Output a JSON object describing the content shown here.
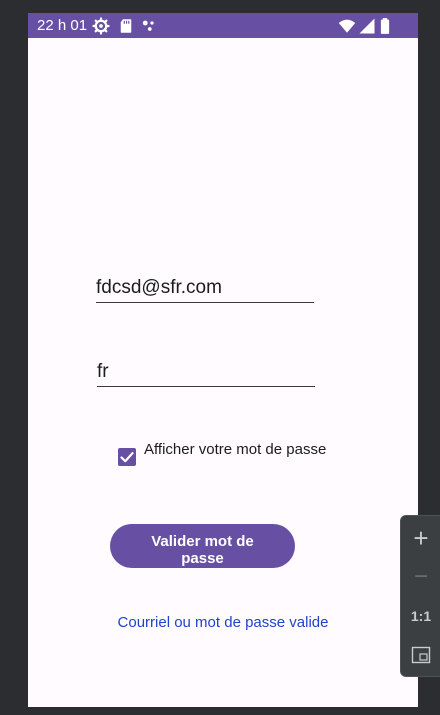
{
  "status_bar": {
    "time": "22 h 01",
    "icons": [
      "gear-icon",
      "sd-card-icon",
      "notification-dots-icon",
      "wifi-icon",
      "signal-icon",
      "battery-icon"
    ],
    "background": "#6750a4"
  },
  "form": {
    "email_value": "fdcsd@sfr.com",
    "password_value": "fr",
    "show_password_label": "Afficher votre mot de passe",
    "show_password_checked": true,
    "validate_button_label": "Valider mot de passe",
    "result_message": "Courriel ou mot de passe valide"
  },
  "zoom_toolbar": {
    "zoom_in": "+",
    "zoom_out": "−",
    "actual_size": "1:1"
  },
  "colors": {
    "accent": "#6750a4",
    "link": "#1f44c8",
    "screen_bg": "#fffbfe",
    "ide_bg": "#2b2d30"
  }
}
